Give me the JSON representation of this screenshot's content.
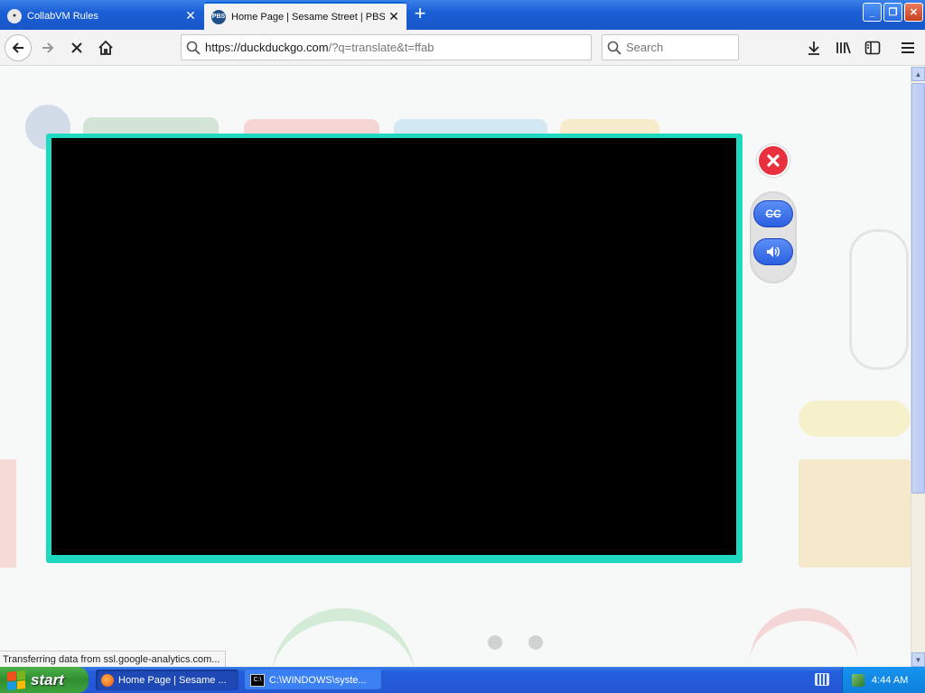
{
  "browser": {
    "tabs": [
      {
        "title": "CollabVM Rules",
        "favicon": "collabvm-icon",
        "active": false
      },
      {
        "title": "Home Page | Sesame Street | PBS",
        "favicon": "PBS KIDS",
        "active": true
      }
    ],
    "new_tab_label": "+",
    "url": "https://duckduckgo.com/?q=translate&t=ffab",
    "url_host": "https://duckduckgo.com",
    "url_rest": "/?q=translate&t=ffab",
    "search_placeholder": "Search",
    "status_text": "Transferring data from ssl.google-analytics.com..."
  },
  "player": {
    "close_label": "✕",
    "cc_label": "CC",
    "volume_icon": "speaker-icon",
    "accent_color": "#1ed9c0",
    "close_color": "#e8303e"
  },
  "taskbar": {
    "start_label": "start",
    "items": [
      {
        "label": "Home Page | Sesame ...",
        "icon": "firefox-icon",
        "active": true
      },
      {
        "label": "C:\\WINDOWS\\syste...",
        "icon": "cmd-icon",
        "active": false
      }
    ],
    "clock": "4:44 AM"
  },
  "colors": {
    "xp_blue": "#245edb",
    "start_green": "#3ea33c"
  }
}
